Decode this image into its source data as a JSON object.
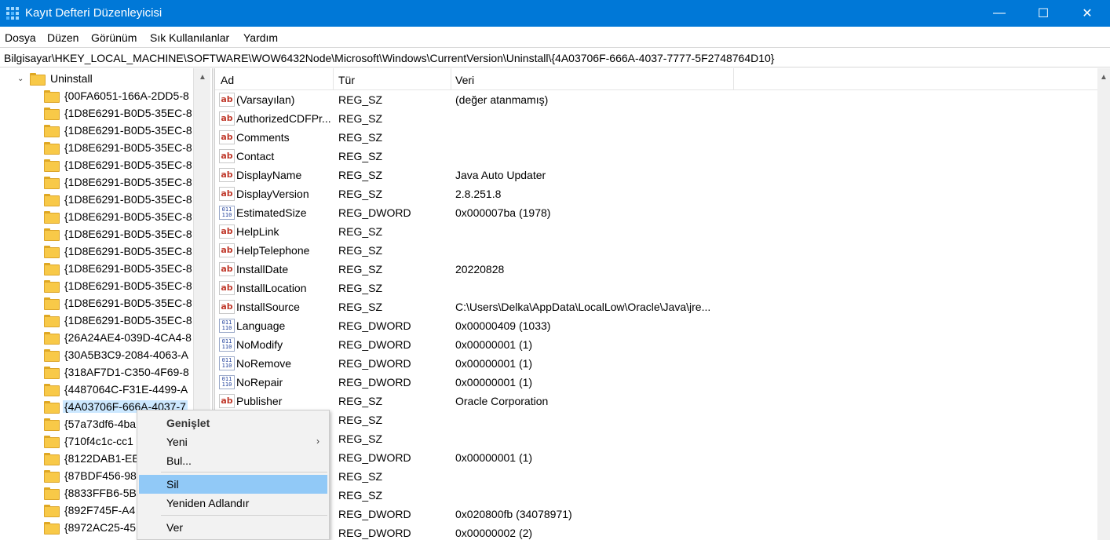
{
  "window": {
    "title": "Kayıt Defteri Düzenleyicisi",
    "minimize_glyph": "—",
    "maximize_glyph": "☐",
    "close_glyph": "✕"
  },
  "menu": [
    "Dosya",
    "Düzen",
    "Görünüm",
    "Sık Kullanılanlar",
    "Yardım"
  ],
  "address": "Bilgisayar\\HKEY_LOCAL_MACHINE\\SOFTWARE\\WOW6432Node\\Microsoft\\Windows\\CurrentVersion\\Uninstall\\{4A03706F-666A-4037-7777-5F2748764D10}",
  "tree": {
    "parent": {
      "label": "Uninstall",
      "expander": "⌄"
    },
    "items": [
      "{00FA6051-166A-2DD5-8",
      "{1D8E6291-B0D5-35EC-8",
      "{1D8E6291-B0D5-35EC-8",
      "{1D8E6291-B0D5-35EC-8",
      "{1D8E6291-B0D5-35EC-8",
      "{1D8E6291-B0D5-35EC-8",
      "{1D8E6291-B0D5-35EC-8",
      "{1D8E6291-B0D5-35EC-8",
      "{1D8E6291-B0D5-35EC-8",
      "{1D8E6291-B0D5-35EC-8",
      "{1D8E6291-B0D5-35EC-8",
      "{1D8E6291-B0D5-35EC-8",
      "{1D8E6291-B0D5-35EC-8",
      "{1D8E6291-B0D5-35EC-8",
      "{26A24AE4-039D-4CA4-8",
      "{30A5B3C9-2084-4063-A",
      "{318AF7D1-C350-4F69-8",
      "{4487064C-F31E-4499-A",
      "{4A03706F-666A-4037-7",
      "{57a73df6-4ba",
      "{710f4c1c-cc1",
      "{8122DAB1-EE",
      "{87BDF456-98",
      "{8833FFB6-5B",
      "{892F745F-A4",
      "{8972AC25-45"
    ],
    "selected_index": 18
  },
  "list": {
    "headers": {
      "name": "Ad",
      "type": "Tür",
      "data": "Veri"
    },
    "rows": [
      {
        "name": "(Varsayılan)",
        "type": "REG_SZ",
        "data": "(değer atanmamış)",
        "icon": "string-value-icon"
      },
      {
        "name": "AuthorizedCDFPr...",
        "type": "REG_SZ",
        "data": "",
        "icon": "string-value-icon"
      },
      {
        "name": "Comments",
        "type": "REG_SZ",
        "data": "",
        "icon": "string-value-icon"
      },
      {
        "name": "Contact",
        "type": "REG_SZ",
        "data": "",
        "icon": "string-value-icon"
      },
      {
        "name": "DisplayName",
        "type": "REG_SZ",
        "data": "Java Auto Updater",
        "icon": "string-value-icon"
      },
      {
        "name": "DisplayVersion",
        "type": "REG_SZ",
        "data": "2.8.251.8",
        "icon": "string-value-icon"
      },
      {
        "name": "EstimatedSize",
        "type": "REG_DWORD",
        "data": "0x000007ba (1978)",
        "icon": "binary-value-icon"
      },
      {
        "name": "HelpLink",
        "type": "REG_SZ",
        "data": "",
        "icon": "string-value-icon"
      },
      {
        "name": "HelpTelephone",
        "type": "REG_SZ",
        "data": "",
        "icon": "string-value-icon"
      },
      {
        "name": "InstallDate",
        "type": "REG_SZ",
        "data": "20220828",
        "icon": "string-value-icon"
      },
      {
        "name": "InstallLocation",
        "type": "REG_SZ",
        "data": "",
        "icon": "string-value-icon"
      },
      {
        "name": "InstallSource",
        "type": "REG_SZ",
        "data": "C:\\Users\\Delka\\AppData\\LocalLow\\Oracle\\Java\\jre...",
        "icon": "string-value-icon"
      },
      {
        "name": "Language",
        "type": "REG_DWORD",
        "data": "0x00000409 (1033)",
        "icon": "binary-value-icon"
      },
      {
        "name": "NoModify",
        "type": "REG_DWORD",
        "data": "0x00000001 (1)",
        "icon": "binary-value-icon"
      },
      {
        "name": "NoRemove",
        "type": "REG_DWORD",
        "data": "0x00000001 (1)",
        "icon": "binary-value-icon"
      },
      {
        "name": "NoRepair",
        "type": "REG_DWORD",
        "data": "0x00000001 (1)",
        "icon": "binary-value-icon"
      },
      {
        "name": "Publisher",
        "type": "REG_SZ",
        "data": "Oracle Corporation",
        "icon": "string-value-icon"
      },
      {
        "name": "",
        "type": "REG_SZ",
        "data": "",
        "icon": ""
      },
      {
        "name": "",
        "type": "REG_SZ",
        "data": "",
        "icon": ""
      },
      {
        "name": "",
        "type": "REG_DWORD",
        "data": "0x00000001 (1)",
        "icon": ""
      },
      {
        "name": "",
        "type": "REG_SZ",
        "data": "",
        "icon": ""
      },
      {
        "name": "",
        "type": "REG_SZ",
        "data": "",
        "icon": ""
      },
      {
        "name": "",
        "type": "REG_DWORD",
        "data": "0x020800fb (34078971)",
        "icon": ""
      },
      {
        "name": "",
        "type": "REG_DWORD",
        "data": "0x00000002 (2)",
        "icon": ""
      }
    ]
  },
  "context_menu": {
    "items": [
      {
        "label": "Genişlet",
        "style": "bold",
        "submenu": false,
        "highlight": false
      },
      {
        "label": "Yeni",
        "style": "normal",
        "submenu": true,
        "highlight": false
      },
      {
        "label": "Bul...",
        "style": "normal",
        "submenu": false,
        "highlight": false
      },
      {
        "label": "Sil",
        "style": "normal",
        "submenu": false,
        "highlight": true
      },
      {
        "label": "Yeniden Adlandır",
        "style": "normal",
        "submenu": false,
        "highlight": false
      },
      {
        "label": "Ver",
        "style": "normal",
        "submenu": false,
        "highlight": false
      }
    ],
    "submenu_glyph": "›"
  },
  "colors": {
    "titlebar": "#0078d7",
    "selection": "#cce8ff",
    "menu_highlight": "#91c9f7"
  }
}
